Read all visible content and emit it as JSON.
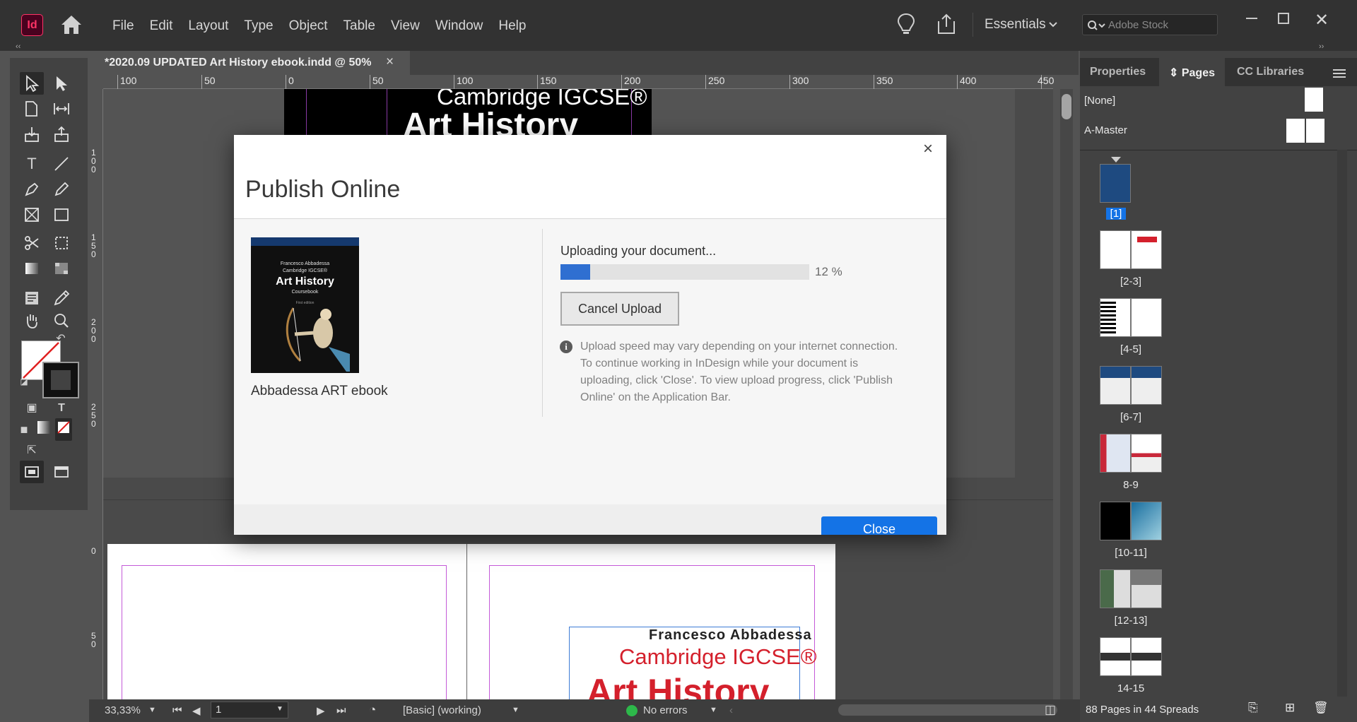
{
  "app": {
    "logo": "Id"
  },
  "menu": [
    "File",
    "Edit",
    "Layout",
    "Type",
    "Object",
    "Table",
    "View",
    "Window",
    "Help"
  ],
  "workspace": "Essentials",
  "stock_search": {
    "placeholder": "Adobe Stock"
  },
  "document_tab": {
    "title": "*2020.09 UPDATED Art History ebook.indd @ 50%",
    "close": "×"
  },
  "ruler": {
    "top_labels": [
      "100",
      "50",
      "0",
      "50",
      "100",
      "150",
      "200",
      "250",
      "300",
      "350",
      "400",
      "450"
    ],
    "left_labels": [
      "1\n0\n0",
      "1\n5\n0",
      "2\n0\n0",
      "2\n5\n0",
      "0",
      "5\n0"
    ]
  },
  "canvas": {
    "top_cover_line1": "Cambridge IGCSE®",
    "top_cover_line2": "Art History",
    "page_author": "Francesco Abbadessa",
    "page_series": "Cambridge IGCSE®",
    "page_title": "Art History"
  },
  "status_bar": {
    "zoom": "33,33%",
    "page": "1",
    "master": "[Basic] (working)",
    "preflight": "No errors"
  },
  "panel": {
    "tabs": [
      "Properties",
      "Pages",
      "CC Libraries"
    ],
    "active_tab": "Pages",
    "masters": [
      "[None]",
      "A-Master"
    ],
    "pages": [
      "[1]",
      "[2-3]",
      "[4-5]",
      "[6-7]",
      "8-9",
      "[10-11]",
      "[12-13]",
      "14-15"
    ],
    "summary": "88 Pages in 44 Spreads"
  },
  "dialog": {
    "title": "Publish Online",
    "close": "×",
    "book_name": "Abbadessa ART ebook",
    "cover": {
      "author": "Francesco Abbadessa",
      "series": "Cambridge IGCSE®",
      "title": "Art History",
      "subtitle": "Coursebook",
      "edition": "First edition"
    },
    "upload_title": "Uploading your document...",
    "progress_percent": 12,
    "progress_label": "12 %",
    "cancel_button": "Cancel Upload",
    "info_text": "Upload speed may vary depending on your internet connection. To continue working in InDesign while your document is uploading, click 'Close'. To view upload progress, click 'Publish Online' on the Application Bar.",
    "close_button": "Close"
  },
  "colors": {
    "accent": "#1473e6",
    "progress": "#2f6fd1",
    "brand_red": "#d4202c"
  }
}
